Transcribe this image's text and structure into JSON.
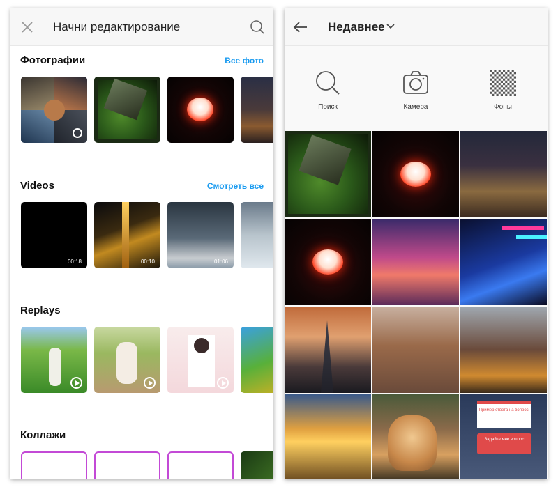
{
  "left": {
    "header": {
      "title": "Начни редактирование",
      "close_icon": "close-icon",
      "search_icon": "search-icon"
    },
    "sections": {
      "photos": {
        "title": "Фотографии",
        "link": "Все фото"
      },
      "videos": {
        "title": "Videos",
        "link": "Смотреть все",
        "durations": [
          "00:18",
          "00:10",
          "01:06"
        ]
      },
      "replays": {
        "title": "Replays"
      },
      "collages": {
        "title": "Коллажи"
      }
    }
  },
  "right": {
    "header": {
      "title": "Недавнее",
      "back_icon": "arrow-left-icon",
      "dropdown_icon": "chevron-down-icon"
    },
    "tools": [
      {
        "label": "Поиск",
        "icon": "search-icon"
      },
      {
        "label": "Камера",
        "icon": "camera-icon"
      },
      {
        "label": "Фоны",
        "icon": "checkerboard-icon"
      }
    ],
    "grid_item_1": {
      "title": "Пример ответа на вопрос!",
      "button": "Задайте мне вопрос"
    }
  },
  "colors": {
    "accent": "#1a9bf0",
    "collage_border": "#c34ad6"
  }
}
